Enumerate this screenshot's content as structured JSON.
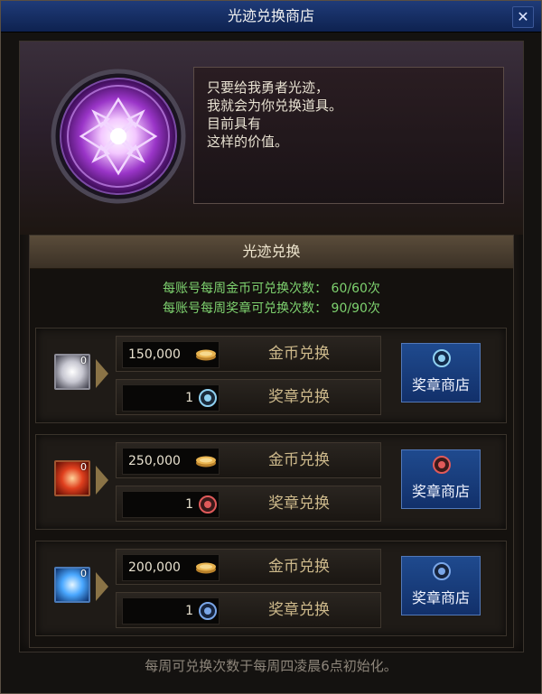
{
  "window": {
    "title": "光迹兑换商店",
    "close_label": "✕"
  },
  "npc": {
    "dialog_lines": [
      "只要给我勇者光迹，",
      "我就会为你兑换道具。",
      "目前具有",
      "这样的价值。"
    ]
  },
  "section": {
    "title": "光迹兑换",
    "quota_gold": "每账号每周金币可兑换次数： 60/60次",
    "quota_medal": "每账号每周奖章可兑换次数： 90/90次"
  },
  "rows": [
    {
      "item_count": "0",
      "item_color": "#c7c7d1",
      "gold_price": "150,000",
      "gold_label": "金币兑换",
      "medal_price": "1",
      "medal_label": "奖章兑换",
      "medal_color": "#8fd0f0",
      "shop_label": "奖章商店"
    },
    {
      "item_count": "0",
      "item_color": "#e0401e",
      "gold_price": "250,000",
      "gold_label": "金币兑换",
      "medal_price": "1",
      "medal_label": "奖章兑换",
      "medal_color": "#e05a5a",
      "shop_label": "奖章商店"
    },
    {
      "item_count": "0",
      "item_color": "#4aa8ff",
      "gold_price": "200,000",
      "gold_label": "金币兑换",
      "medal_price": "1",
      "medal_label": "奖章兑换",
      "medal_color": "#7aa6e8",
      "shop_label": "奖章商店"
    }
  ],
  "footer": {
    "text": "每周可兑换次数于每周四凌晨6点初始化。"
  },
  "icons": {
    "emblem": "purple-emblem-icon",
    "coin": "gold-coin-icon",
    "medal": "medal-icon",
    "arrow": "arrow-right-icon"
  }
}
